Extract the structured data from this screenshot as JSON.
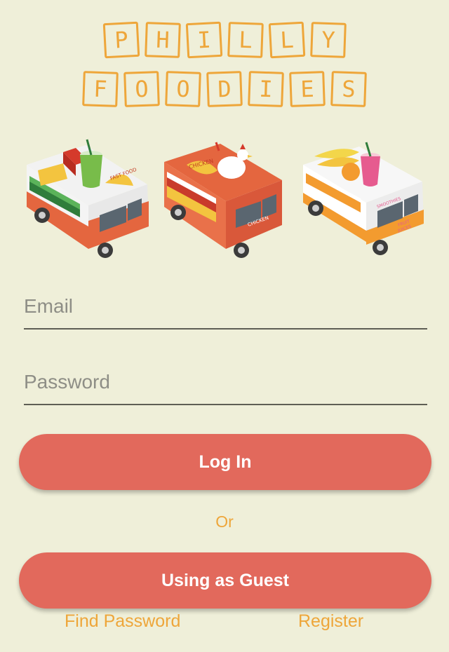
{
  "logo": {
    "row1": [
      "P",
      "H",
      "I",
      "L",
      "L",
      "Y"
    ],
    "row2": [
      "F",
      "O",
      "O",
      "D",
      "I",
      "E",
      "S"
    ],
    "color": "#eea63a"
  },
  "trucks": {
    "fast_food": {
      "sign": "FAST FOOD"
    },
    "chicken": {
      "sign": "CHICKEN",
      "side": "CHICKEN"
    },
    "smoothies": {
      "sign": "SMOOTHIES",
      "side1": "FRUIT",
      "side2": "JUICES"
    }
  },
  "form": {
    "email_placeholder": "Email",
    "password_placeholder": "Password"
  },
  "buttons": {
    "login": "Log In",
    "or": "Or",
    "guest": "Using as Guest"
  },
  "links": {
    "find_password": "Find Password",
    "register": "Register"
  },
  "colors": {
    "background": "#efefd9",
    "button": "#e2695c",
    "accent": "#eea63a"
  }
}
